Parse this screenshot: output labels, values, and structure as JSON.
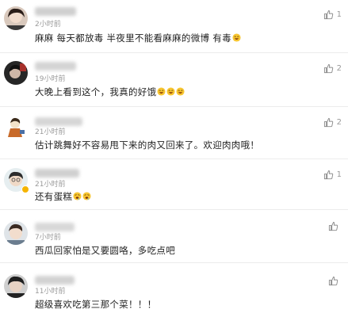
{
  "comments": [
    {
      "time": "2小时前",
      "text": "麻麻  每天都放毒  半夜里不能看麻麻的微博  有毒",
      "emoji": [
        "laugh-emoji"
      ],
      "likes": "1"
    },
    {
      "time": "19小时前",
      "text": "大晚上看到这个，我真的好饿",
      "emoji": [
        "laugh-emoji",
        "laugh-emoji",
        "laugh-emoji"
      ],
      "likes": "2"
    },
    {
      "time": "21小时前",
      "text": "估计跳舞好不容易甩下来的肉又回来了。欢迎肉肉哦！",
      "emoji": [],
      "likes": "2"
    },
    {
      "time": "21小时前",
      "text": "还有蛋糕",
      "emoji": [
        "drool-emoji",
        "drool-emoji"
      ],
      "likes": "1"
    },
    {
      "time": "7小时前",
      "text": "西瓜回家怕是又要圆咯，多吃点吧",
      "emoji": [],
      "likes": ""
    },
    {
      "time": "11小时前",
      "text": "超级喜欢吃第三那个菜！！！",
      "emoji": [],
      "likes": ""
    }
  ],
  "colors": {
    "accent_badge": "#f5b400",
    "time_gray": "#9a9a9a",
    "divider": "#ececec"
  }
}
